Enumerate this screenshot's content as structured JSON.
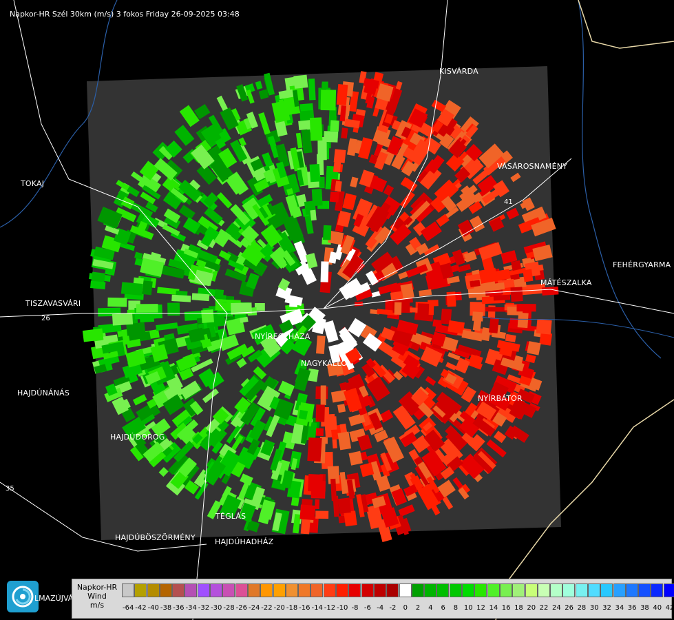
{
  "title": "Napkor-HR Szél 30km (m/s) 3 fokos Friday 26-09-2025 03:48",
  "cities": [
    {
      "id": "kisvarda",
      "name": "KISVÁRDA"
    },
    {
      "id": "vasarosnameny",
      "name": "VÁSÁROSNAMÉNY"
    },
    {
      "id": "tokaj",
      "name": "TOKAJ"
    },
    {
      "id": "fehergyarmat",
      "name": "FEHÉRGYARMA"
    },
    {
      "id": "mateszalka",
      "name": "MÁTÉSZALKA"
    },
    {
      "id": "tiszavasvari",
      "name": "TISZAVASVÁRI"
    },
    {
      "id": "nyiregyhaza",
      "name": "NYÍREGYHÁZA"
    },
    {
      "id": "nagykallo",
      "name": "NAGYKÁLLÓ"
    },
    {
      "id": "hajdunanas",
      "name": "HAJDÚNÁNÁS"
    },
    {
      "id": "nyirbator",
      "name": "NYÍRBÁTOR"
    },
    {
      "id": "hajdudorog",
      "name": "HAJDÚDOROG"
    },
    {
      "id": "teglas",
      "name": "TÉGLÁS"
    },
    {
      "id": "hajduboszormeny",
      "name": "HAJDÚBÖSZÖRMÉNY"
    },
    {
      "id": "hajduhadhaz",
      "name": "HAJDÚHADHÁZ"
    },
    {
      "id": "balmazujvaros",
      "name": "LMAZÚJVÁR"
    }
  ],
  "roads": [
    "35",
    "26",
    "41"
  ],
  "legend": {
    "label_line1": "Napkor-HR",
    "label_line2": "Wind",
    "label_line3": "m/s",
    "ticks": [
      "-64",
      "-42",
      "-40",
      "-38",
      "-36",
      "-34",
      "-32",
      "-30",
      "-28",
      "-26",
      "-24",
      "-22",
      "-20",
      "-18",
      "-16",
      "-14",
      "-12",
      "-10",
      "-8",
      "-6",
      "-4",
      "-2",
      "0",
      "2",
      "4",
      "6",
      "8",
      "10",
      "12",
      "14",
      "16",
      "18",
      "20",
      "22",
      "24",
      "26",
      "28",
      "30",
      "32",
      "34",
      "36",
      "38",
      "40",
      "42"
    ],
    "colors": [
      "#c8c8c8",
      "#b4a000",
      "#b48c00",
      "#b46400",
      "#b45050",
      "#b450b4",
      "#a050ff",
      "#b450dc",
      "#c850b4",
      "#dc5096",
      "#e07828",
      "#ff9600",
      "#ffa000",
      "#f09030",
      "#f07828",
      "#f06428",
      "#ff3c14",
      "#ff1e00",
      "#e60000",
      "#d20000",
      "#be0000",
      "#aa0000",
      "#ffffff",
      "#00a000",
      "#00b400",
      "#00be00",
      "#00c800",
      "#00dc00",
      "#28e600",
      "#50f028",
      "#78f050",
      "#a0f078",
      "#c8ff78",
      "#c8ffb4",
      "#b4ffc8",
      "#a0ffdc",
      "#78f0f0",
      "#50dcff",
      "#28c8ff",
      "#28a0ff",
      "#1e78ff",
      "#1450ff",
      "#0a28ff",
      "#0000ff"
    ]
  }
}
